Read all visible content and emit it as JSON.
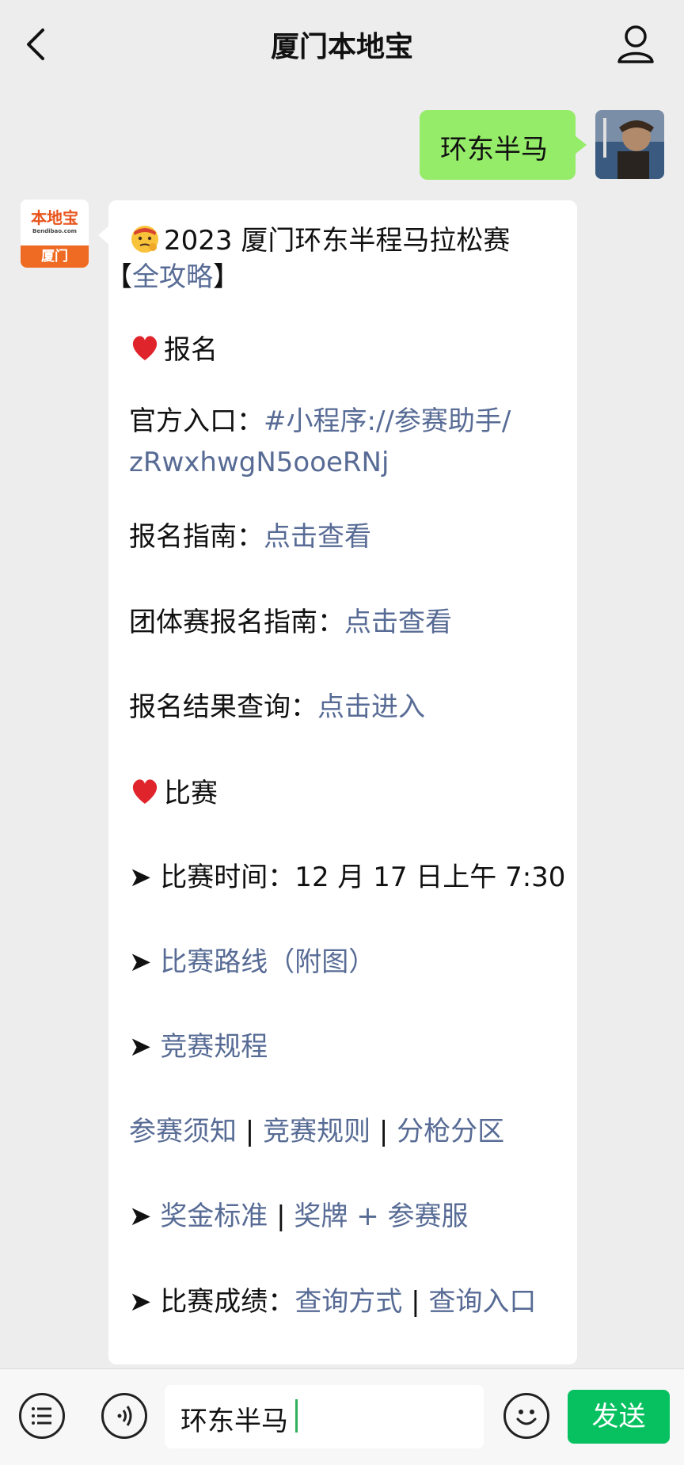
{
  "header": {
    "title": "厦门本地宝",
    "back_icon": "chevron-left-icon",
    "user_icon": "person-icon"
  },
  "user_message": {
    "text": "环东半马"
  },
  "bot_avatar": {
    "logo_cn": "本地宝",
    "logo_en": "Bendibao.com",
    "city": "厦门"
  },
  "bot_message": {
    "heading": "2023 厦门环东半程马拉松赛",
    "heading_link_open": "【",
    "heading_link": "全攻略",
    "heading_link_close": "】",
    "section1": "报名",
    "entry_label": "官方入口：",
    "entry_link_1": "#小程序://参赛助手/",
    "entry_link_2": "zRwxhwgN5ooeRNj",
    "guide_label": "报名指南：",
    "guide_link": "点击查看",
    "team_label": "团体赛报名指南：",
    "team_link": "点击查看",
    "result_label": "报名结果查询：",
    "result_link": "点击进入",
    "section2": "比赛",
    "arrow": "➤",
    "time_label": "比赛时间：12 月 17 日上午 7:30",
    "route_link": "比赛路线（附图）",
    "rules_link": "竞赛规程",
    "notice_link": "参赛须知",
    "sep": " | ",
    "rule2_link": "竞赛规则",
    "zone_link": "分枪分区",
    "prize_link": "奖金标准",
    "medal_link": "奖牌 + 参赛服",
    "score_label": "比赛成绩：",
    "score_link1": "查询方式",
    "score_link2": "查询入口"
  },
  "input_bar": {
    "value": "环东半马",
    "send_label": "发送"
  },
  "colors": {
    "link": "#576b95",
    "user_bubble": "#95ec69",
    "send_button": "#07c160"
  }
}
